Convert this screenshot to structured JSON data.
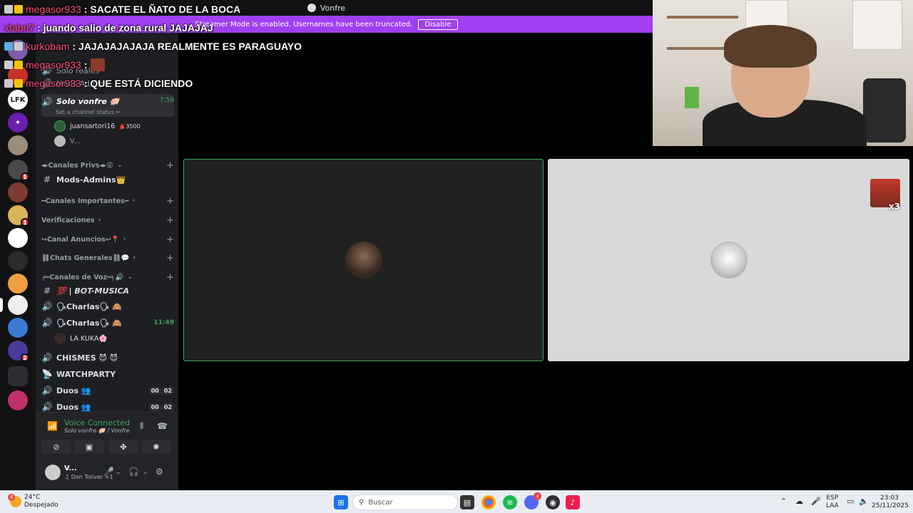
{
  "window": {
    "title": "Vonfre"
  },
  "banner": {
    "text": "Streamer Mode is enabled. Usernames have been truncated.",
    "disable_label": "Disable"
  },
  "chat_overlay": [
    {
      "user": "megasor933",
      "message": "SACATE EL ÑATO DE LA BOCA"
    },
    {
      "user": "xfabri7",
      "message": "juando salio de zona rural JAJAJAJ"
    },
    {
      "user": "kurkobam",
      "message": "JAJAJAJAJAJA REALMENTE ES PARAGUAYO"
    },
    {
      "user": "megasor933",
      "message": ""
    },
    {
      "user": "megasor933",
      "message": "QUE ESTÁ DICIENDO"
    }
  ],
  "sidebar": {
    "channels_top": [
      {
        "name": "Solo reales",
        "icon": "speaker-icon"
      },
      {
        "name": "Mods-Admins",
        "icon": "speaker-icon"
      }
    ],
    "active_channel": {
      "name": "Solo vonfre 🐖",
      "status": "Set a channel status ✏",
      "time": "7:59"
    },
    "active_members": [
      {
        "name": "juansartori16",
        "extra": "🩸3500"
      },
      {
        "name": "V..."
      }
    ],
    "categories": [
      {
        "label": "◂▸Canales Privs◂▸😜",
        "chevron": "⌄"
      },
      {
        "label": "━Canales Importantes━",
        "chevron": "›"
      },
      {
        "label": "Verificaciones",
        "chevron": "›"
      },
      {
        "label": "↪Canal Anuncios↩📍",
        "chevron": "›"
      },
      {
        "label": "⛓Chats Generales⛓💬",
        "chevron": "›"
      },
      {
        "label": "╒═Canales de Voz═╕🔊",
        "chevron": "⌄"
      }
    ],
    "mods_admins_channel": "Mods-Admins👑",
    "voice_channels": [
      {
        "name": "💯 | BOT-MUSICA",
        "icon": "#"
      },
      {
        "name": "🗣Charlas🗣 🙈",
        "icon": "🔊"
      },
      {
        "name": "🗣Charlas🗣 🙈",
        "icon": "🔊",
        "time": "11:49"
      },
      {
        "name": "CHISMES 😈 😈",
        "icon": "🔊"
      },
      {
        "name": "WATCHPARTY",
        "icon": "📡"
      },
      {
        "name": "Duos 👥",
        "icon": "🔊",
        "counts": [
          "00",
          "02"
        ]
      },
      {
        "name": "Duos 👥",
        "icon": "🔊",
        "counts": [
          "00",
          "02"
        ]
      }
    ],
    "charlas_member": "LA KUKA🌸"
  },
  "voice_panel": {
    "title": "Voice Connected",
    "subtitle": "Solo vonfre 🐖 / Vonfre"
  },
  "user_panel": {
    "name": "V...",
    "status": "♫ Don Toliver +1"
  },
  "call": {
    "emote_count": "x3"
  },
  "taskbar": {
    "weather_temp": "24°C",
    "weather_desc": "Despejado",
    "weather_badge": "4",
    "search_placeholder": "Buscar",
    "lang": "ESP",
    "lang_sub": "LAA",
    "time": "23:03",
    "date": "25/11/2025",
    "discord_badge": "4"
  },
  "server_badges": [
    "1",
    "1",
    "2"
  ],
  "colors": {
    "accent": "#a040f0",
    "online": "#3ba55d",
    "chat_user": "#ff4d7a"
  }
}
